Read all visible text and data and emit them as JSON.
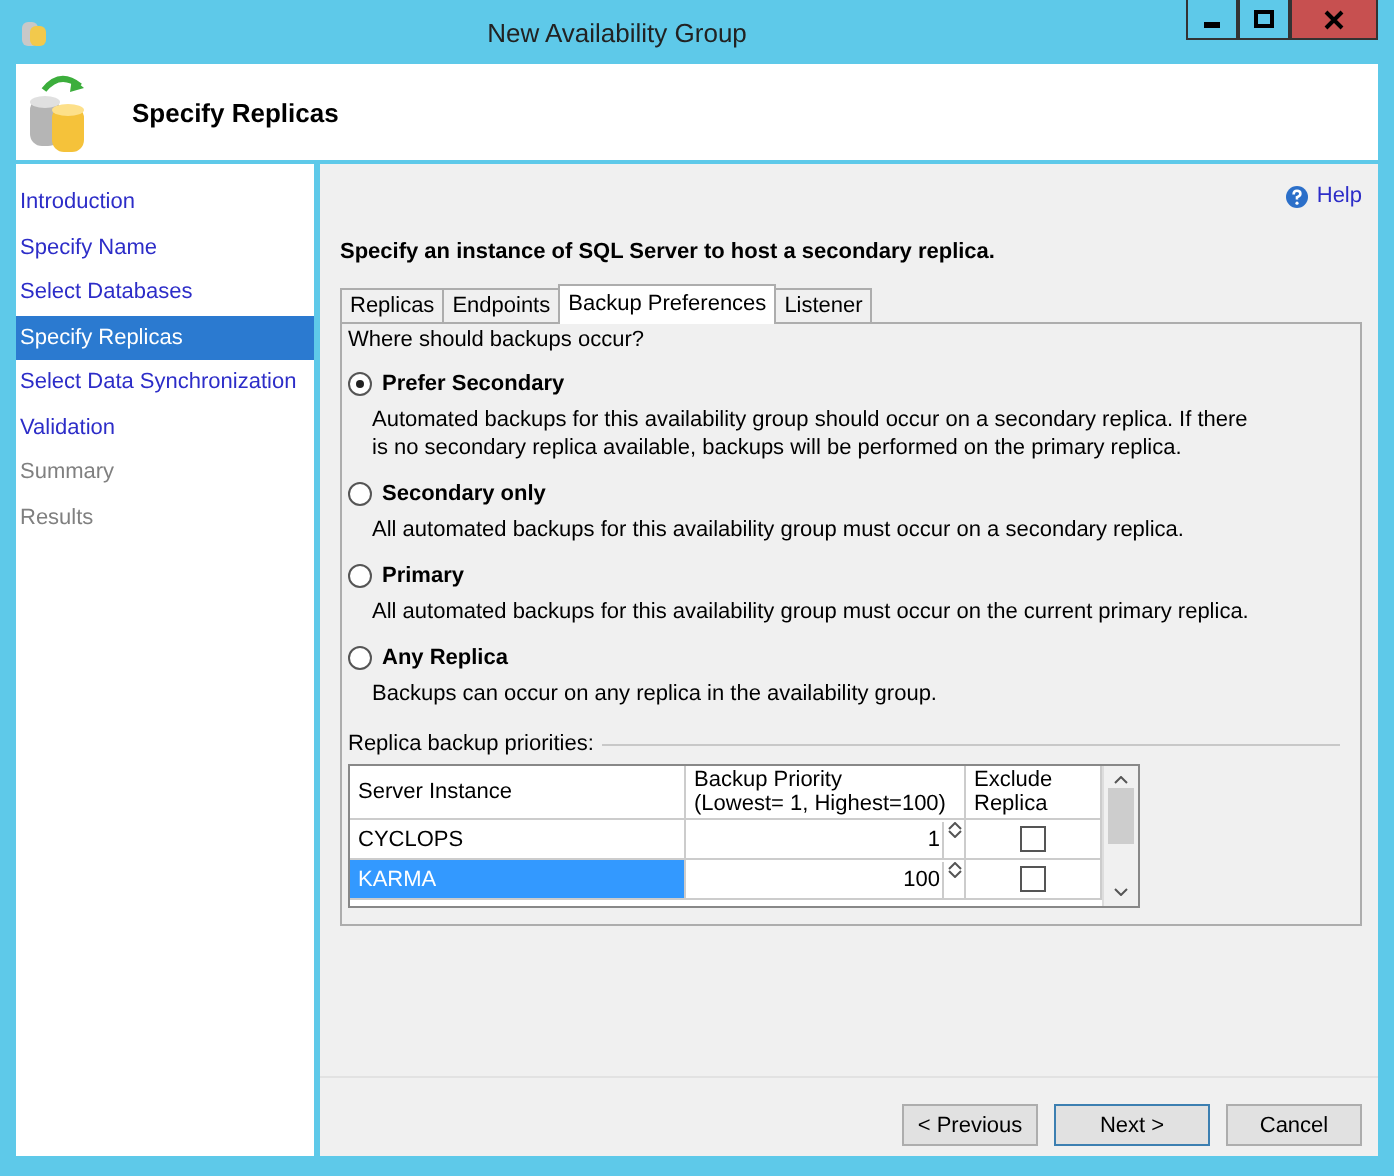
{
  "window": {
    "title": "New Availability Group"
  },
  "header": {
    "title": "Specify Replicas"
  },
  "nav": [
    {
      "label": "Introduction",
      "selected": false,
      "disabled": false
    },
    {
      "label": "Specify Name",
      "selected": false,
      "disabled": false
    },
    {
      "label": "Select Databases",
      "selected": false,
      "disabled": false
    },
    {
      "label": "Specify Replicas",
      "selected": true,
      "disabled": false
    },
    {
      "label": "Select Data Synchronization",
      "selected": false,
      "disabled": false
    },
    {
      "label": "Validation",
      "selected": false,
      "disabled": false
    },
    {
      "label": "Summary",
      "selected": false,
      "disabled": true
    },
    {
      "label": "Results",
      "selected": false,
      "disabled": true
    }
  ],
  "help": {
    "label": "Help"
  },
  "instruction": "Specify an instance of SQL Server to host a secondary replica.",
  "tabs": [
    {
      "label": "Replicas",
      "selected": false
    },
    {
      "label": "Endpoints",
      "selected": false
    },
    {
      "label": "Backup Preferences",
      "selected": true
    },
    {
      "label": "Listener",
      "selected": false
    }
  ],
  "question": "Where should backups occur?",
  "options": [
    {
      "label": "Prefer Secondary",
      "description": "Automated backups for this availability group should occur on a secondary replica. If there is no secondary replica available, backups will be performed on the primary replica.",
      "selected": true
    },
    {
      "label": "Secondary only",
      "description": "All automated backups for this availability group must occur on a secondary replica.",
      "selected": false
    },
    {
      "label": "Primary",
      "description": "All automated backups for this availability group must occur on the current primary replica.",
      "selected": false
    },
    {
      "label": "Any Replica",
      "description": "Backups can occur on any replica in the availability group.",
      "selected": false
    }
  ],
  "priorities": {
    "label": "Replica backup priorities:",
    "columns": [
      "Server Instance",
      "Backup Priority\n(Lowest= 1, Highest=100)",
      "Exclude\nReplica"
    ],
    "rows": [
      {
        "server": "CYCLOPS",
        "priority": "1",
        "exclude": false,
        "selected": false
      },
      {
        "server": "KARMA",
        "priority": "100",
        "exclude": false,
        "selected": true
      }
    ]
  },
  "buttons": [
    {
      "label": "< Previous",
      "default": false
    },
    {
      "label": "Next >",
      "default": true
    },
    {
      "label": "Cancel",
      "default": false
    }
  ]
}
